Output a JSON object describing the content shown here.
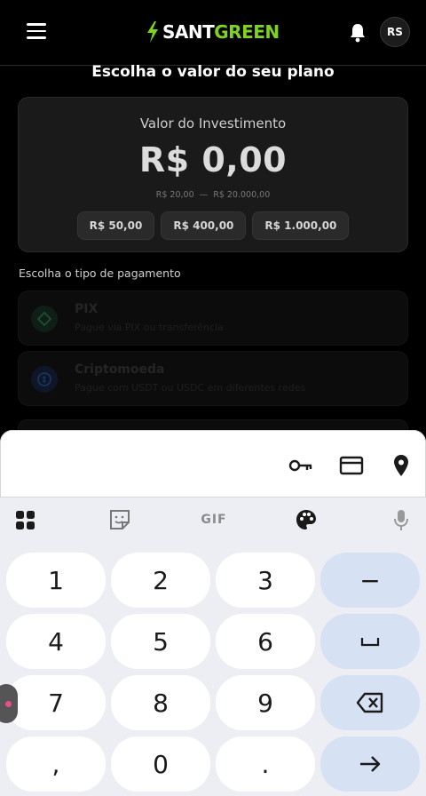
{
  "header": {
    "brand_part1": "SANT",
    "brand_part2": "GREEN",
    "avatar_initials": "RS"
  },
  "plan": {
    "title": "Escolha o valor do seu plano",
    "investment_label": "Valor do Investimento",
    "amount": "R$ 0,00",
    "range_min": "R$ 20,00",
    "range_sep": "—",
    "range_max": "R$ 20.000,00",
    "presets": [
      "R$ 50,00",
      "R$ 400,00",
      "R$ 1.000,00"
    ]
  },
  "payment": {
    "label": "Escolha o tipo de pagamento",
    "options": [
      {
        "title": "PIX",
        "subtitle": "Pague via PIX ou transferência"
      },
      {
        "title": "Criptomoeda",
        "subtitle": "Pague com USDT ou USDC em diferentes redes"
      }
    ]
  },
  "keyboard": {
    "gif_label": "GIF",
    "rows": [
      [
        "1",
        "2",
        "3",
        "−"
      ],
      [
        "4",
        "5",
        "6",
        "␣"
      ],
      [
        "7",
        "8",
        "9",
        "⌫"
      ],
      [
        ",",
        "0",
        ".",
        "→"
      ]
    ],
    "icons": [
      "key-icon",
      "credit-card-icon",
      "location-pin-icon",
      "apps-grid-icon",
      "sticker-icon",
      "palette-icon",
      "microphone-icon"
    ]
  },
  "colors": {
    "brand_green": "#7ed321",
    "background": "#000000",
    "card": "#1a1a1a",
    "keyboard_bg": "#eceef4",
    "key_fn": "#d6e1f3"
  }
}
